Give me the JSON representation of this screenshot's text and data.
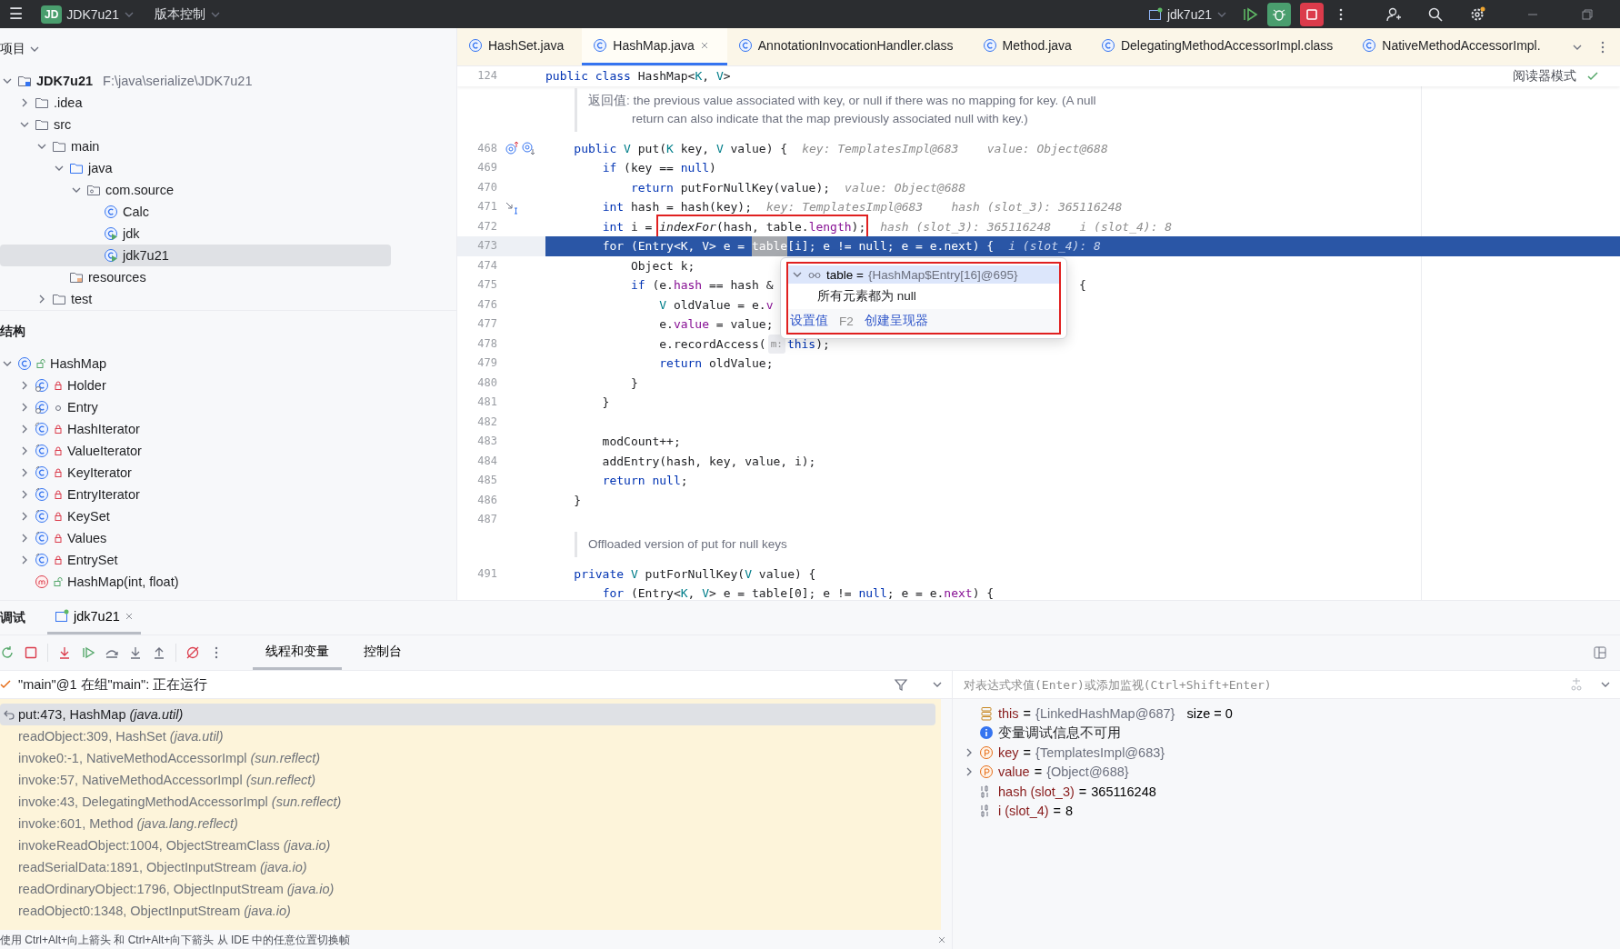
{
  "title_bar": {
    "menu": "☰",
    "project_badge": "JD",
    "project": "JDK7u21",
    "vcs": "版本控制",
    "run_config": "jdk7u21"
  },
  "project_panel": {
    "title": "项目",
    "tree": [
      {
        "label": "JDK7u21",
        "path": "F:\\java\\serialize\\JDK7u21",
        "kind": "module",
        "expanded": true,
        "selected": false,
        "children": [
          {
            "label": ".idea",
            "kind": "folder",
            "expanded": false,
            "selected": false
          },
          {
            "label": "src",
            "kind": "folder",
            "expanded": true,
            "selected": false,
            "children": [
              {
                "label": "main",
                "kind": "folder",
                "expanded": true,
                "selected": false,
                "children": [
                  {
                    "label": "java",
                    "kind": "source",
                    "expanded": true,
                    "selected": false,
                    "children": [
                      {
                        "label": "com.source",
                        "kind": "package",
                        "expanded": true,
                        "selected": false,
                        "children": [
                          {
                            "label": "Calc",
                            "runnable": false,
                            "selected": false
                          },
                          {
                            "label": "jdk",
                            "runnable": true,
                            "selected": false
                          },
                          {
                            "label": "jdk7u21",
                            "runnable": true,
                            "selected": true
                          }
                        ]
                      }
                    ]
                  },
                  {
                    "label": "resources",
                    "kind": "resources",
                    "selected": false
                  }
                ]
              },
              {
                "label": "test",
                "kind": "folder",
                "expanded": false,
                "selected": false
              }
            ]
          }
        ]
      }
    ]
  },
  "structure_panel": {
    "title": "结构",
    "tree": [
      {
        "label": "HashMap",
        "kind": "public-class",
        "expanded": true,
        "selected": false,
        "children": [
          {
            "label": "Holder",
            "kind": "private-static-class",
            "expanded": false,
            "selected": false
          },
          {
            "label": "Entry",
            "kind": "package-static-class",
            "expanded": false,
            "selected": false
          },
          {
            "label": "HashIterator",
            "kind": "private-abstract-class",
            "expanded": false,
            "selected": false
          },
          {
            "label": "ValueIterator",
            "kind": "private-final-class",
            "expanded": false,
            "selected": false
          },
          {
            "label": "KeyIterator",
            "kind": "private-final-class",
            "expanded": false,
            "selected": false
          },
          {
            "label": "EntryIterator",
            "kind": "private-final-class",
            "expanded": false,
            "selected": false
          },
          {
            "label": "KeySet",
            "kind": "private-final-class",
            "expanded": false,
            "selected": false
          },
          {
            "label": "Values",
            "kind": "private-final-class",
            "expanded": false,
            "selected": false
          },
          {
            "label": "EntrySet",
            "kind": "private-final-class",
            "expanded": false,
            "selected": false
          },
          {
            "label": "HashMap(int, float)",
            "kind": "public-method",
            "selected": false
          }
        ]
      }
    ]
  },
  "editor": {
    "tabs": [
      {
        "label": "HashSet.java",
        "selected": false
      },
      {
        "label": "HashMap.java",
        "selected": true
      },
      {
        "label": "AnnotationInvocationHandler.class",
        "selected": false
      },
      {
        "label": "Method.java",
        "selected": false
      },
      {
        "label": "DelegatingMethodAccessorImpl.class",
        "selected": false
      },
      {
        "label": "NativeMethodAccessorImpl.",
        "selected": false
      }
    ],
    "reader_mode": "阅读器模式",
    "sticky": {
      "n": "124",
      "segments": [
        {
          "kind": "code",
          "text": "public class HashMap<K, V>"
        }
      ]
    },
    "blocks": [
      {
        "kind": "doc",
        "lines": [
          "返回值: the previous value associated with key, or null if there was no mapping for key. (A null",
          "return can also indicate that the map previously associated null with key.)"
        ]
      },
      {
        "kind": "code",
        "n": "468",
        "gutter_icons": [
          {
            "kind": "override"
          },
          {
            "kind": "implemented"
          }
        ],
        "current": false,
        "segments": [
          {
            "kind": "code",
            "text": "    public V put(K key, V value) {"
          },
          {
            "kind": "hint",
            "text": "key: TemplatesImpl@683    value: Object@688"
          }
        ]
      },
      {
        "kind": "code",
        "n": "469",
        "current": false,
        "segments": [
          {
            "kind": "code",
            "text": "        if (key == null)"
          }
        ]
      },
      {
        "kind": "code",
        "n": "470",
        "current": false,
        "segments": [
          {
            "kind": "code",
            "text": "            return putForNullKey(value);"
          },
          {
            "kind": "hint",
            "text": "value: Object@688"
          }
        ]
      },
      {
        "kind": "code",
        "n": "471",
        "gutter_icons": [
          {
            "kind": "step-into"
          }
        ],
        "current": false,
        "segments": [
          {
            "kind": "code",
            "text": "        int hash = hash(key);"
          },
          {
            "kind": "hint",
            "text": "key: TemplatesImpl@683    hash (slot_3): 365116248"
          }
        ]
      },
      {
        "kind": "code",
        "n": "472",
        "current": false,
        "segments": [
          {
            "kind": "code",
            "text": "        int i = "
          },
          {
            "kind": "box",
            "text": "*indexFor*(hash, table.length);"
          },
          {
            "kind": "hint",
            "text": "hash (slot_3): 365116248    i (slot_4): 8"
          }
        ]
      },
      {
        "kind": "code",
        "n": "473",
        "current": true,
        "segments": [
          {
            "kind": "code",
            "text": "        for (Entry<K, V> e = "
          },
          {
            "kind": "selection",
            "text": "table"
          },
          {
            "kind": "code",
            "text": "[i]; e != null; e = e.next) {"
          },
          {
            "kind": "hint",
            "text": "i (slot_4): 8"
          }
        ]
      },
      {
        "kind": "code",
        "n": "474",
        "current": false,
        "segments": [
          {
            "kind": "code",
            "text": "            Object k;"
          }
        ]
      },
      {
        "kind": "code",
        "n": "475",
        "current": false,
        "segments": [
          {
            "kind": "code",
            "text": "            if (e.hash == hash &"
          },
          {
            "kind": "tail",
            "text": "{"
          }
        ]
      },
      {
        "kind": "code",
        "n": "476",
        "current": false,
        "segments": [
          {
            "kind": "code",
            "text": "                V oldValue = e.v"
          }
        ]
      },
      {
        "kind": "code",
        "n": "477",
        "current": false,
        "segments": [
          {
            "kind": "code",
            "text": "                e.value = value;"
          }
        ]
      },
      {
        "kind": "code",
        "n": "478",
        "current": false,
        "segments": [
          {
            "kind": "code",
            "text": "                e.recordAccess("
          },
          {
            "kind": "param",
            "text": "m:"
          },
          {
            "kind": "code",
            "text": "this);"
          }
        ]
      },
      {
        "kind": "code",
        "n": "479",
        "current": false,
        "segments": [
          {
            "kind": "code",
            "text": "                return oldValue;"
          }
        ]
      },
      {
        "kind": "code",
        "n": "480",
        "current": false,
        "segments": [
          {
            "kind": "code",
            "text": "            }"
          }
        ]
      },
      {
        "kind": "code",
        "n": "481",
        "current": false,
        "segments": [
          {
            "kind": "code",
            "text": "        }"
          }
        ]
      },
      {
        "kind": "code",
        "n": "482",
        "current": false
      },
      {
        "kind": "code",
        "n": "483",
        "current": false,
        "segments": [
          {
            "kind": "code",
            "text": "        modCount++;"
          }
        ]
      },
      {
        "kind": "code",
        "n": "484",
        "current": false,
        "segments": [
          {
            "kind": "code",
            "text": "        addEntry(hash, key, value, i);"
          }
        ]
      },
      {
        "kind": "code",
        "n": "485",
        "current": false,
        "segments": [
          {
            "kind": "code",
            "text": "        return null;"
          }
        ]
      },
      {
        "kind": "code",
        "n": "486",
        "current": false,
        "segments": [
          {
            "kind": "code",
            "text": "    }"
          }
        ]
      },
      {
        "kind": "code",
        "n": "487",
        "current": false
      },
      {
        "kind": "doc",
        "lines": [
          "Offloaded version of put for null keys"
        ]
      },
      {
        "kind": "code",
        "n": "491",
        "current": false,
        "segments": [
          {
            "kind": "code",
            "text": "    private V putForNullKey(V value) {"
          }
        ]
      },
      {
        "kind": "code",
        "current": false,
        "segments": [
          {
            "kind": "code",
            "text": "        for (Entry<K, V> e = table[0]; e != null; e = e.next) {"
          }
        ]
      }
    ],
    "popup": {
      "name": "table",
      "eq": "=",
      "value": "{HashMap$Entry[16]@695}",
      "expanded": true,
      "message": "所有元素都为 null",
      "set_value": "设置值",
      "shortcut": "F2",
      "create_renderer": "创建呈现器"
    }
  },
  "debug": {
    "title": "调试",
    "session": {
      "label": "jdk7u21",
      "selected": true
    },
    "tabs": [
      {
        "label": "线程和变量",
        "selected": true
      },
      {
        "label": "控制台",
        "selected": false
      }
    ],
    "thread": "\"main\"@1 在组\"main\": 正在运行",
    "frames": [
      {
        "method": "put:473, HashMap",
        "package": "(java.util)",
        "selected": true
      },
      {
        "method": "readObject:309, HashSet",
        "package": "(java.util)",
        "selected": false
      },
      {
        "method": "invoke0:-1, NativeMethodAccessorImpl",
        "package": "(sun.reflect)",
        "selected": false
      },
      {
        "method": "invoke:57, NativeMethodAccessorImpl",
        "package": "(sun.reflect)",
        "selected": false
      },
      {
        "method": "invoke:43, DelegatingMethodAccessorImpl",
        "package": "(sun.reflect)",
        "selected": false
      },
      {
        "method": "invoke:601, Method",
        "package": "(java.lang.reflect)",
        "selected": false
      },
      {
        "method": "invokeReadObject:1004, ObjectStreamClass",
        "package": "(java.io)",
        "selected": false
      },
      {
        "method": "readSerialData:1891, ObjectInputStream",
        "package": "(java.io)",
        "selected": false
      },
      {
        "method": "readOrdinaryObject:1796, ObjectInputStream",
        "package": "(java.io)",
        "selected": false
      },
      {
        "method": "readObject0:1348, ObjectInputStream",
        "package": "(java.io)",
        "selected": false
      }
    ],
    "hint": "使用 Ctrl+Alt+向上箭头 和 Ctrl+Alt+向下箭头 从 IDE 中的任意位置切换帧",
    "eval_placeholder": "对表达式求值(Enter)或添加监视(Ctrl+Shift+Enter)",
    "variables": [
      {
        "kind": "field",
        "name": "this",
        "eq": "=",
        "value": "{LinkedHashMap@687}",
        "extra": "size = 0"
      },
      {
        "kind": "info",
        "text": "变量调试信息不可用"
      },
      {
        "kind": "param",
        "name": "key",
        "eq": "=",
        "value": "{TemplatesImpl@683}",
        "expanded": false
      },
      {
        "kind": "param",
        "name": "value",
        "eq": "=",
        "value": "{Object@688}",
        "expanded": false
      },
      {
        "kind": "local",
        "name": "hash (slot_3)",
        "eq": "=",
        "value": "365116248"
      },
      {
        "kind": "local",
        "name": "i (slot_4)",
        "eq": "=",
        "value": "8"
      }
    ]
  }
}
